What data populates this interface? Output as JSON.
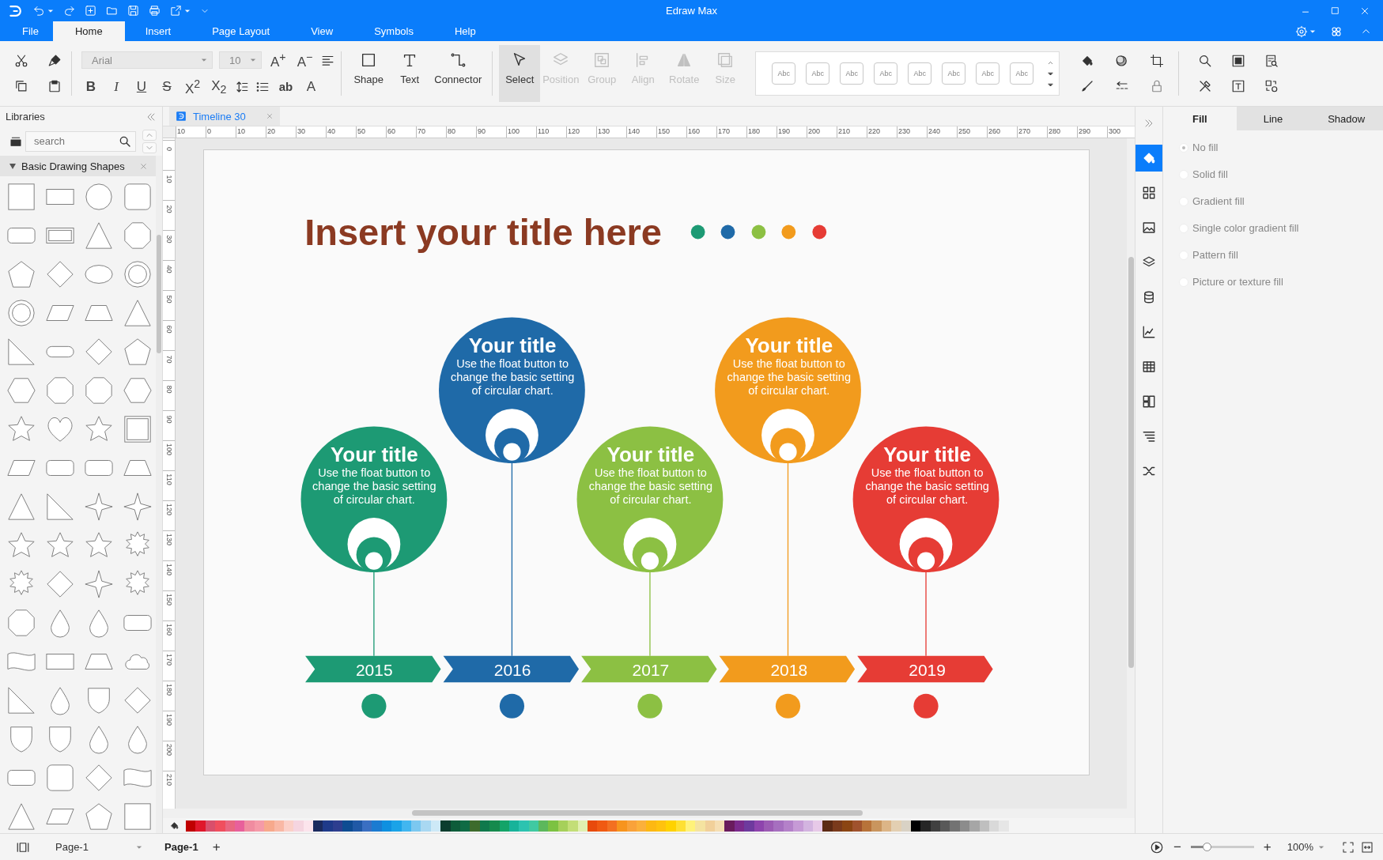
{
  "window": {
    "title": "Edraw Max"
  },
  "menu_tabs": [
    {
      "label": "File",
      "selected": false
    },
    {
      "label": "Home",
      "selected": true
    },
    {
      "label": "Insert",
      "selected": false
    },
    {
      "label": "Page Layout",
      "selected": false
    },
    {
      "label": "View",
      "selected": false
    },
    {
      "label": "Symbols",
      "selected": false
    },
    {
      "label": "Help",
      "selected": false
    }
  ],
  "toolbar": {
    "font": "Arial",
    "font_size": "10",
    "grow_font": "A$^{+}$",
    "shrink_font": "A$^{−}$",
    "format_buttons": [
      "B",
      "I",
      "U",
      "S",
      "X$^{2}$",
      "X$_{2}$"
    ],
    "case_button": "ab",
    "color_button": "A",
    "tools": [
      {
        "label": "Shape",
        "selected": false,
        "disabled": false
      },
      {
        "label": "Text",
        "selected": false,
        "disabled": false
      },
      {
        "label": "Connector",
        "selected": false,
        "disabled": false
      },
      {
        "label": "Select",
        "selected": true,
        "disabled": false
      },
      {
        "label": "Position",
        "selected": false,
        "disabled": true
      },
      {
        "label": "Group",
        "selected": false,
        "disabled": true
      },
      {
        "label": "Align",
        "selected": false,
        "disabled": true
      },
      {
        "label": "Rotate",
        "selected": false,
        "disabled": true
      },
      {
        "label": "Size",
        "selected": false,
        "disabled": true
      }
    ],
    "styles": [
      "Abc",
      "Abc",
      "Abc",
      "Abc",
      "Abc",
      "Abc",
      "Abc",
      "Abc"
    ]
  },
  "document_tab": {
    "label": "Timeline 30"
  },
  "libraries": {
    "title": "Libraries",
    "search": {
      "placeholder": "search"
    },
    "section": {
      "label": "Basic Drawing Shapes",
      "expanded": true
    }
  },
  "rulers": {
    "horizontal": [
      "10",
      "0",
      "10",
      "20",
      "30",
      "40",
      "50",
      "60",
      "70",
      "80",
      "90",
      "100",
      "110",
      "120",
      "130",
      "140",
      "150",
      "160",
      "170",
      "180",
      "190",
      "200",
      "210",
      "220",
      "230",
      "240",
      "250",
      "260",
      "270",
      "280",
      "290",
      "300"
    ],
    "vertical": [
      "0",
      "10",
      "20",
      "30",
      "40",
      "50",
      "60",
      "70",
      "80",
      "90",
      "100",
      "110",
      "120",
      "130",
      "140",
      "150",
      "160",
      "170",
      "180",
      "190",
      "200",
      "210"
    ]
  },
  "diagram": {
    "title": "Insert your title here",
    "dots": [
      {
        "color": "#1d9a74"
      },
      {
        "color": "#1f6aa8"
      },
      {
        "color": "#8cc043"
      },
      {
        "color": "#f29b1d"
      },
      {
        "color": "#e63c35"
      }
    ],
    "milestones": [
      {
        "year": "2015",
        "title": "Your title",
        "body": "Use the float button to change the basic setting of circular chart.",
        "color": "#1d9a74"
      },
      {
        "year": "2016",
        "title": "Your title",
        "body": "Use the float button to change the basic setting of circular chart.",
        "color": "#1f6aa8"
      },
      {
        "year": "2017",
        "title": "Your title",
        "body": "Use the float button to change the basic setting of circular chart.",
        "color": "#8cc043"
      },
      {
        "year": "2018",
        "title": "Your title",
        "body": "Use the float button to change the basic setting of circular chart.",
        "color": "#f29b1d"
      },
      {
        "year": "2019",
        "title": "Your title",
        "body": "Use the float button to change the basic setting of circular chart.",
        "color": "#e63c35"
      }
    ]
  },
  "palette": [
    {
      "color": "#c00000"
    },
    {
      "color": "#e0182b"
    },
    {
      "color": "#d94f6b"
    },
    {
      "color": "#f04f5e"
    },
    {
      "color": "#e96680"
    },
    {
      "color": "#e8609b"
    },
    {
      "color": "#f08ca0"
    },
    {
      "color": "#f59aa8"
    },
    {
      "color": "#f7a98c"
    },
    {
      "color": "#f9b8a5"
    },
    {
      "color": "#fbd0c8"
    },
    {
      "color": "#f5d5e0"
    },
    {
      "color": "#fce4ec"
    },
    {
      "color": "#1b2a5e"
    },
    {
      "color": "#1f3a8a"
    },
    {
      "color": "#2e3e8f"
    },
    {
      "color": "#0e4c92"
    },
    {
      "color": "#2059a6"
    },
    {
      "color": "#3a6fc2"
    },
    {
      "color": "#1b7bd1"
    },
    {
      "color": "#0f90e0"
    },
    {
      "color": "#1aa3e8"
    },
    {
      "color": "#41b6f0"
    },
    {
      "color": "#7cc8f0"
    },
    {
      "color": "#a9d8f2"
    },
    {
      "color": "#cde9f7"
    },
    {
      "color": "#0b3d2e"
    },
    {
      "color": "#0d5c3a"
    },
    {
      "color": "#0f6b45"
    },
    {
      "color": "#3d6b2c"
    },
    {
      "color": "#10794c"
    },
    {
      "color": "#158a4d"
    },
    {
      "color": "#13a468"
    },
    {
      "color": "#18b39a"
    },
    {
      "color": "#2cc3b0"
    },
    {
      "color": "#40c9a2"
    },
    {
      "color": "#5cb85c"
    },
    {
      "color": "#7cc242"
    },
    {
      "color": "#a6d05a"
    },
    {
      "color": "#c3de77"
    },
    {
      "color": "#e0efb0"
    },
    {
      "color": "#e84a0c"
    },
    {
      "color": "#f05a12"
    },
    {
      "color": "#f37021"
    },
    {
      "color": "#f7941d"
    },
    {
      "color": "#f9a23a"
    },
    {
      "color": "#fbb03b"
    },
    {
      "color": "#fdb813"
    },
    {
      "color": "#ffc20e"
    },
    {
      "color": "#ffd200"
    },
    {
      "color": "#fee033"
    },
    {
      "color": "#fff27a"
    },
    {
      "color": "#f5e3a0"
    },
    {
      "color": "#f1d09a"
    },
    {
      "color": "#f5deb3"
    },
    {
      "color": "#6a1b5d"
    },
    {
      "color": "#7b2a8c"
    },
    {
      "color": "#6e3a9e"
    },
    {
      "color": "#8e44ad"
    },
    {
      "color": "#9c5bb4"
    },
    {
      "color": "#a66fbf"
    },
    {
      "color": "#b481c9"
    },
    {
      "color": "#c69ad6"
    },
    {
      "color": "#d3b4e0"
    },
    {
      "color": "#e7c9e8"
    },
    {
      "color": "#5c2a14"
    },
    {
      "color": "#7a3a1c"
    },
    {
      "color": "#8b4513"
    },
    {
      "color": "#a0522d"
    },
    {
      "color": "#b8733a"
    },
    {
      "color": "#c9955e"
    },
    {
      "color": "#dcb587"
    },
    {
      "color": "#e3cfb2"
    },
    {
      "color": "#d9d2c5"
    },
    {
      "color": "#000000"
    },
    {
      "color": "#262626"
    },
    {
      "color": "#404040"
    },
    {
      "color": "#595959"
    },
    {
      "color": "#737373"
    },
    {
      "color": "#8c8c8c"
    },
    {
      "color": "#a6a6a6"
    },
    {
      "color": "#bfbfbf"
    },
    {
      "color": "#d9d9d9"
    },
    {
      "color": "#e6e6e6"
    }
  ],
  "properties": {
    "tabs": [
      {
        "label": "Fill",
        "selected": true
      },
      {
        "label": "Line",
        "selected": false
      },
      {
        "label": "Shadow",
        "selected": false
      }
    ],
    "fill_options": [
      {
        "label": "No fill",
        "selected": true
      },
      {
        "label": "Solid fill",
        "selected": false
      },
      {
        "label": "Gradient fill",
        "selected": false
      },
      {
        "label": "Single color gradient fill",
        "selected": false
      },
      {
        "label": "Pattern fill",
        "selected": false
      },
      {
        "label": "Picture or texture fill",
        "selected": false
      }
    ]
  },
  "status_bar": {
    "page_select": "Page-1",
    "page_tab": "Page-1",
    "add_page": "+",
    "zoom_out": "−",
    "zoom": {
      "level": 0.25
    },
    "zoom_in": "+",
    "zoom_value": "100%"
  }
}
